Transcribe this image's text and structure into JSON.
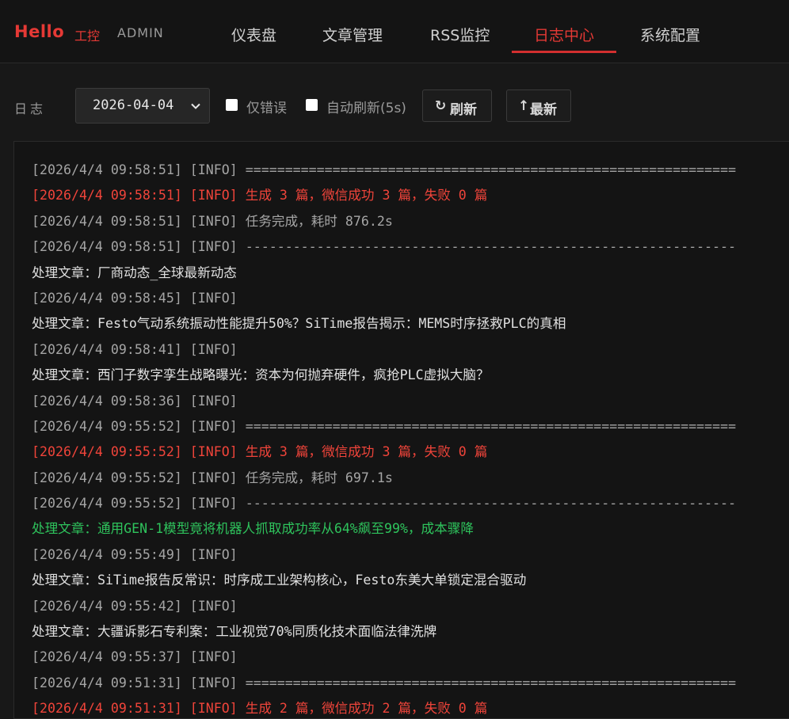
{
  "brand": {
    "hello": "Hello",
    "sub": "工控",
    "admin": "ADMIN"
  },
  "nav": [
    {
      "label": "仪表盘"
    },
    {
      "label": "文章管理"
    },
    {
      "label": "RSS监控"
    },
    {
      "label": "日志中心",
      "active": true
    },
    {
      "label": "系统配置"
    }
  ],
  "toolbar": {
    "label": "日志",
    "date_value": "2026-04-04",
    "errors_only_label": "仅错误",
    "auto_refresh_label": "自动刷新(5s)",
    "refresh_icon": "↻",
    "refresh_label": "刷新",
    "latest_icon": "↑",
    "latest_label": "最新"
  },
  "colors": {
    "accent": "#e53935",
    "background": "#181818",
    "summary_text": "#f0443a",
    "success_text": "#2ec35c",
    "info_text": "#a5a5a5"
  },
  "log_lines": [
    {
      "kind": "info",
      "text": "[2026/4/4 09:58:51] [INFO] =============================================================="
    },
    {
      "kind": "summary",
      "text": "[2026/4/4 09:58:51] [INFO] 生成 3 篇，微信成功 3 篇，失败 0 篇"
    },
    {
      "kind": "info",
      "text": "[2026/4/4 09:58:51] [INFO] 任务完成，耗时 876.2s"
    },
    {
      "kind": "info",
      "text": "[2026/4/4 09:58:51] [INFO] --------------------------------------------------------------"
    },
    {
      "kind": "article",
      "text": "处理文章：厂商动态_全球最新动态"
    },
    {
      "kind": "info",
      "text": "[2026/4/4 09:58:45] [INFO]"
    },
    {
      "kind": "article",
      "text": "处理文章：Festo气动系统振动性能提升50%？SiTime报告揭示：MEMS时序拯救PLC的真相"
    },
    {
      "kind": "info",
      "text": "[2026/4/4 09:58:41] [INFO]"
    },
    {
      "kind": "article",
      "text": "处理文章：西门子数字孪生战略曝光：资本为何抛弃硬件，疯抢PLC虚拟大脑？"
    },
    {
      "kind": "info",
      "text": "[2026/4/4 09:58:36] [INFO]"
    },
    {
      "kind": "info",
      "text": "[2026/4/4 09:55:52] [INFO] =============================================================="
    },
    {
      "kind": "summary",
      "text": "[2026/4/4 09:55:52] [INFO] 生成 3 篇，微信成功 3 篇，失败 0 篇"
    },
    {
      "kind": "info",
      "text": "[2026/4/4 09:55:52] [INFO] 任务完成，耗时 697.1s"
    },
    {
      "kind": "info",
      "text": "[2026/4/4 09:55:52] [INFO] --------------------------------------------------------------"
    },
    {
      "kind": "success",
      "text": "处理文章：通用GEN-1模型竟将机器人抓取成功率从64%飙至99%，成本骤降"
    },
    {
      "kind": "info",
      "text": "[2026/4/4 09:55:49] [INFO]"
    },
    {
      "kind": "article",
      "text": "处理文章：SiTime报告反常识：时序成工业架构核心，Festo东美大单锁定混合驱动"
    },
    {
      "kind": "info",
      "text": "[2026/4/4 09:55:42] [INFO]"
    },
    {
      "kind": "article",
      "text": "处理文章：大疆诉影石专利案：工业视觉70%同质化技术面临法律洗牌"
    },
    {
      "kind": "info",
      "text": "[2026/4/4 09:55:37] [INFO]"
    },
    {
      "kind": "info",
      "text": "[2026/4/4 09:51:31] [INFO] =============================================================="
    },
    {
      "kind": "summary",
      "text": "[2026/4/4 09:51:31] [INFO] 生成 2 篇，微信成功 2 篇，失败 0 篇"
    }
  ]
}
